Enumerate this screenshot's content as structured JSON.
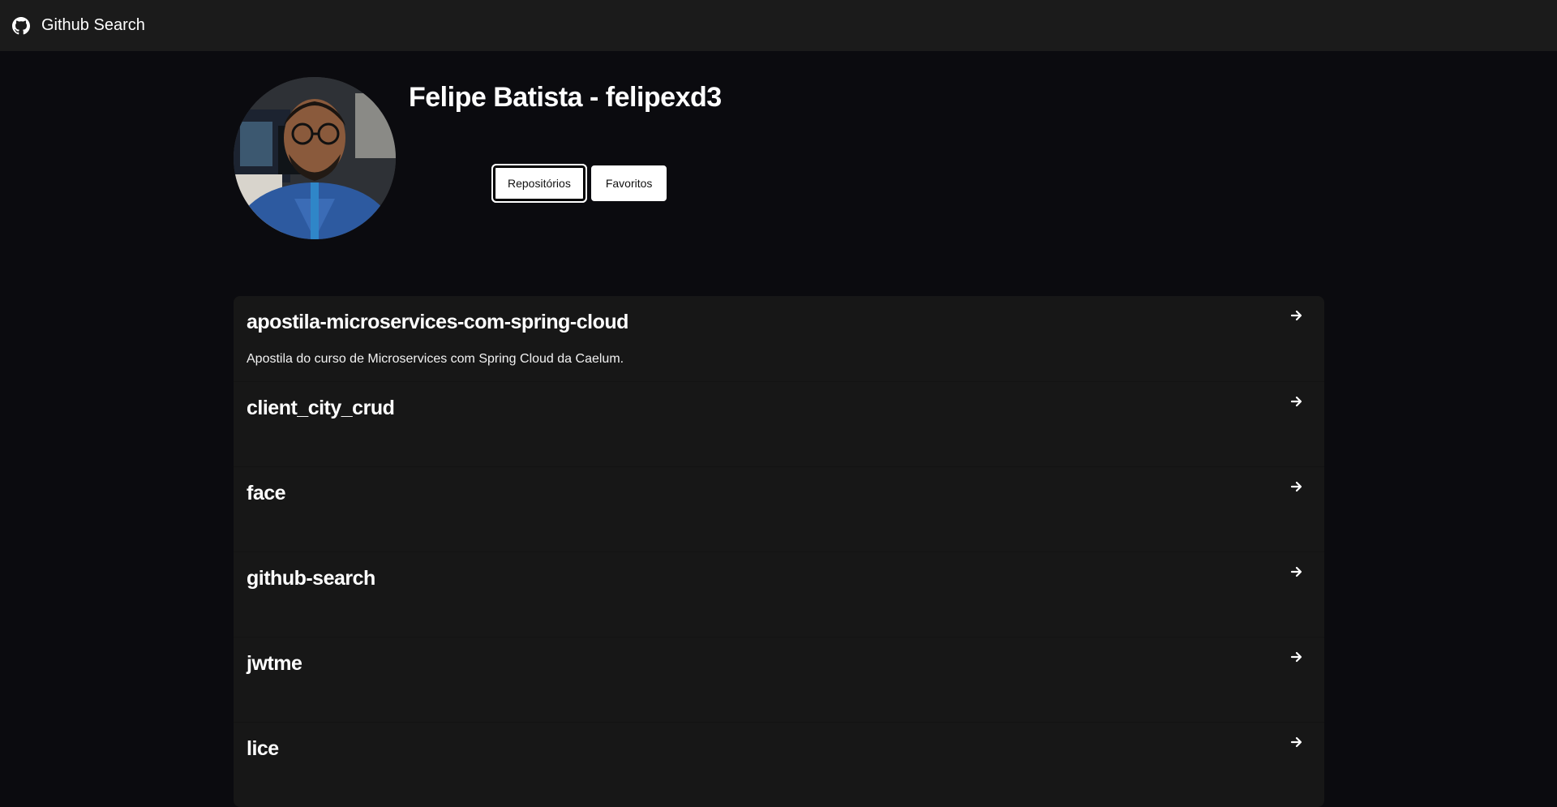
{
  "header": {
    "logo_icon": "github-icon",
    "title": "Github Search"
  },
  "profile": {
    "avatar_icon": "avatar",
    "name": "Felipe Batista - felipexd3",
    "tabs": [
      {
        "label": "Repositórios",
        "active": true
      },
      {
        "label": "Favoritos",
        "active": false
      }
    ]
  },
  "repos": [
    {
      "name": "apostila-microservices-com-spring-cloud",
      "description": "Apostila do curso de Microservices com Spring Cloud da Caelum."
    },
    {
      "name": "client_city_crud",
      "description": ""
    },
    {
      "name": "face",
      "description": ""
    },
    {
      "name": "github-search",
      "description": ""
    },
    {
      "name": "jwtme",
      "description": ""
    },
    {
      "name": "lice",
      "description": ""
    }
  ],
  "colors": {
    "background": "#0b0b0f",
    "topbar": "#1b1b1b",
    "card": "#171717",
    "button": "#ffffff"
  }
}
